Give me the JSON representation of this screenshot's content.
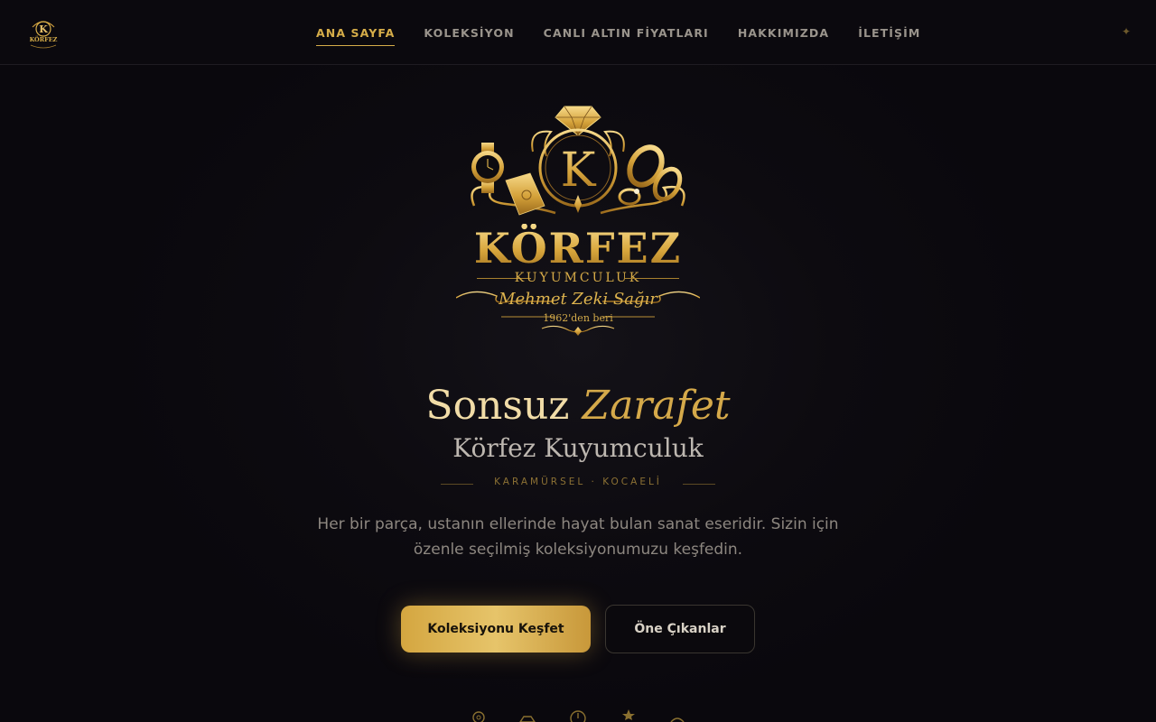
{
  "nav": {
    "logo_icon": "korfez-crest-logo",
    "links": [
      {
        "label": "ANA SAYFA",
        "active": true
      },
      {
        "label": "KOLEKSİYON",
        "active": false
      },
      {
        "label": "CANLI ALTIN FİYATLARI",
        "active": false
      },
      {
        "label": "HAKKIMIZDA",
        "active": false
      },
      {
        "label": "İLETİŞİM",
        "active": false
      }
    ],
    "right_icon": "sparkle-icon",
    "right_glyph": "✦"
  },
  "emblem": {
    "icon": "korfez-crest-emblem",
    "monogram": "K",
    "brand": "KÖRFEZ",
    "brand_sub": "KUYUMCULUK",
    "owner": "Mehmet Zeki Sağır",
    "since": "1962'den beri"
  },
  "hero": {
    "headline_main": "Sonsuz",
    "headline_accent": "Zarafet",
    "subtitle": "Körfez Kuyumculuk",
    "location": "KARAMÜRSEL · KOCAELİ",
    "description": "Her bir parça, ustanın ellerinde hayat bulan sanat eseridir. Sizin için özenle seçilmiş koleksiyonumuzu keşfedin.",
    "primary_button": "Koleksiyonu Keşfet",
    "secondary_button": "Öne Çıkanlar"
  },
  "feature_icons": [
    "ring-icon",
    "gold-bar-icon",
    "compass-icon",
    "star-icon",
    "gem-icon"
  ],
  "colors": {
    "gold_accent": "#d6ad49",
    "background": "#0b090e",
    "button_gold": "#e6c46a"
  }
}
